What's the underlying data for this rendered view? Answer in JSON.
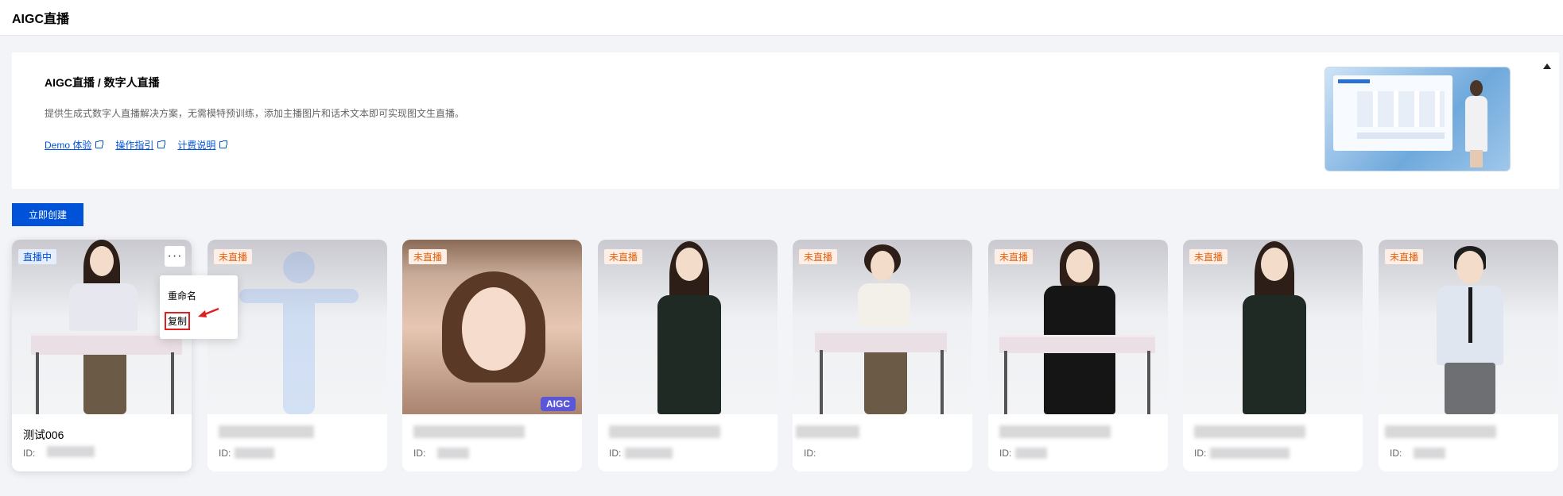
{
  "app_title": "AIGC直播",
  "banner": {
    "title": "AIGC直播 / 数字人直播",
    "description": "提供生成式数字人直播解决方案，无需模特预训练，添加主播图片和话术文本即可实现图文生直播。",
    "links": [
      "Demo 体验",
      "操作指引",
      "计费说明"
    ]
  },
  "create_button": "立即创建",
  "context_menu": {
    "items": [
      "重命名",
      "复制"
    ]
  },
  "cards": [
    {
      "status": "直播中",
      "status_type": "live",
      "name": "测试006",
      "id_label": "ID:"
    },
    {
      "status": "未直播",
      "status_type": "idle",
      "name": "",
      "id_label": "ID:"
    },
    {
      "status": "未直播",
      "status_type": "idle",
      "name": "",
      "id_label": "ID:",
      "tag": "AIGC"
    },
    {
      "status": "未直播",
      "status_type": "idle",
      "name": "",
      "id_label": "ID:"
    },
    {
      "status": "未直播",
      "status_type": "idle",
      "name": "",
      "id_label": "ID:"
    },
    {
      "status": "未直播",
      "status_type": "idle",
      "name": "",
      "id_label": "ID:"
    },
    {
      "status": "未直播",
      "status_type": "idle",
      "name": "",
      "id_label": "ID:"
    },
    {
      "status": "未直播",
      "status_type": "idle",
      "name": "",
      "id_label": "ID:"
    }
  ],
  "colors": {
    "primary": "#0052d9",
    "live_badge_bg": "#e6eefc",
    "idle_badge_fg": "#e5620e",
    "aigc_tag": "#5a56d9",
    "highlight": "#e02020"
  }
}
